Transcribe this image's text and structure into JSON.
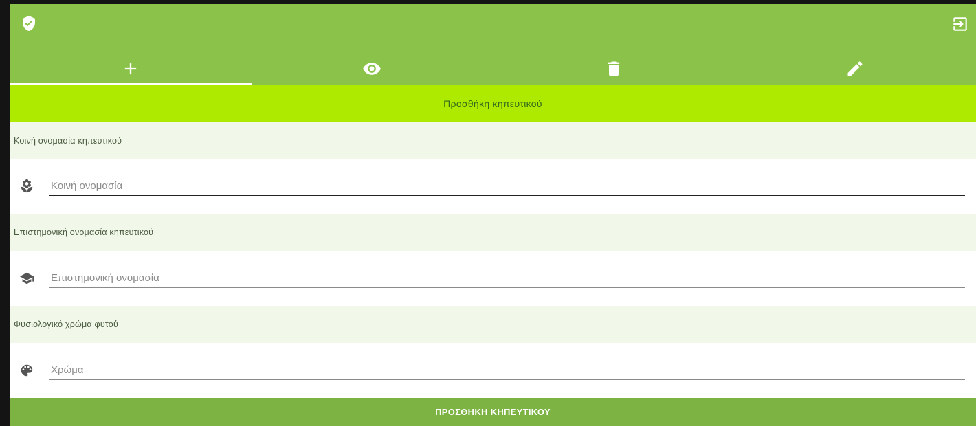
{
  "header": {
    "logo_icon": "shield-check-icon",
    "logout_icon": "exit-icon",
    "colors": {
      "bar": "#8bc34a",
      "icons": "#ffffff"
    }
  },
  "tabs": [
    {
      "icon": "plus-icon",
      "active": true
    },
    {
      "icon": "eye-icon",
      "active": false
    },
    {
      "icon": "trash-icon",
      "active": false
    },
    {
      "icon": "pencil-icon",
      "active": false
    }
  ],
  "subheader": {
    "title": "Προσθήκη κηπευτικού",
    "color": "#aeea00"
  },
  "form": {
    "common_name": {
      "section_label": "Κοινή ονομασία κηπευτικού",
      "icon": "flower-icon",
      "placeholder": "Κοινή ονομασία",
      "value": ""
    },
    "scientific_name": {
      "section_label": "Επιστημονική ονομασία κηπευτικού",
      "icon": "graduation-cap-icon",
      "placeholder": "Επιστημονική ονομασία",
      "value": ""
    },
    "color": {
      "section_label": "Φυσιολογικό χρώμα φυτού",
      "icon": "palette-icon",
      "placeholder": "Χρώμα",
      "value": ""
    }
  },
  "submit": {
    "label": "ΠΡΟΣΘΗΚΗ ΚΗΠΕΥΤΙΚΟΥ",
    "color": "#7cb342"
  }
}
